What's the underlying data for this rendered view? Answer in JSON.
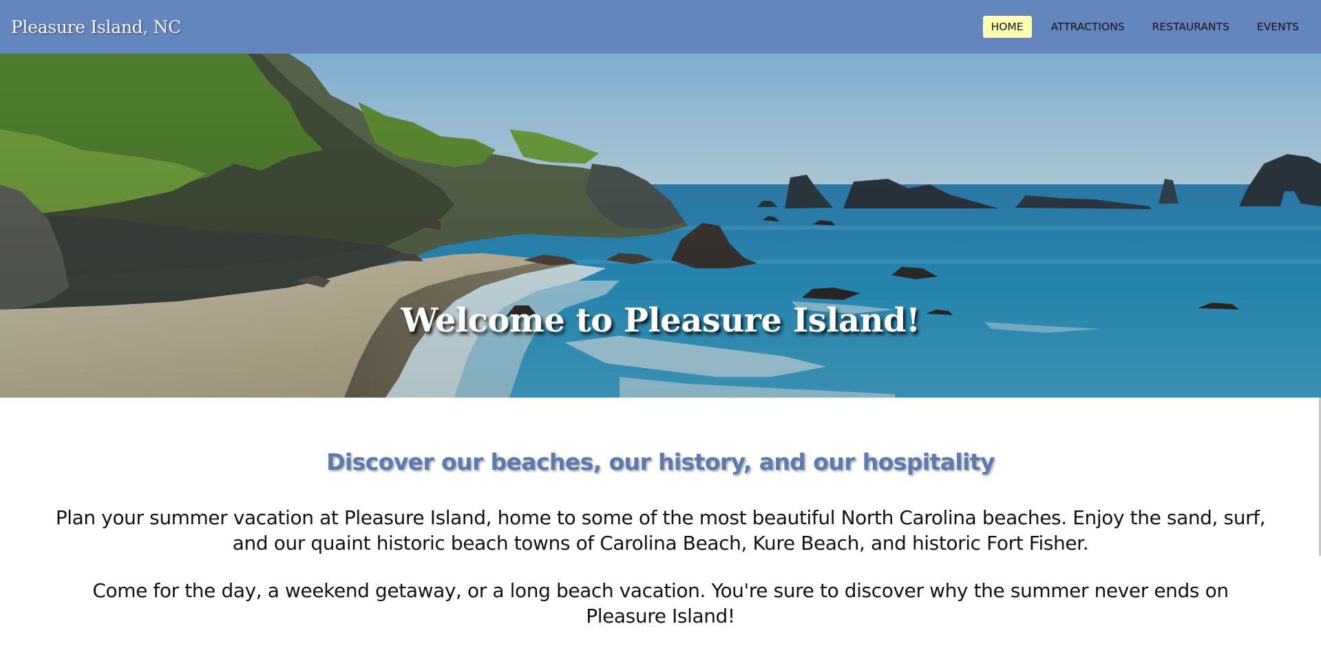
{
  "header": {
    "site_title": "Pleasure Island, NC",
    "nav": [
      {
        "label": "HOME",
        "active": true
      },
      {
        "label": "ATTRACTIONS",
        "active": false
      },
      {
        "label": "RESTAURANTS",
        "active": false
      },
      {
        "label": "EVENTS",
        "active": false
      }
    ]
  },
  "hero": {
    "title": "Welcome to Pleasure Island!"
  },
  "main": {
    "subtitle": "Discover our beaches, our history, and our hospitality",
    "paragraph1": "Plan your summer vacation at Pleasure Island, home to some of the most beautiful North Carolina beaches. Enjoy the sand, surf, and our quaint historic beach towns of Carolina Beach, Kure Beach, and historic Fort Fisher.",
    "paragraph2": "Come for the day, a weekend getaway, or a long beach vacation. You're sure to discover why the summer never ends on Pleasure Island!"
  },
  "colors": {
    "header_bg": "#6486bf",
    "active_nav_bg": "#ffffb3",
    "subtitle": "#5b7ab0"
  }
}
